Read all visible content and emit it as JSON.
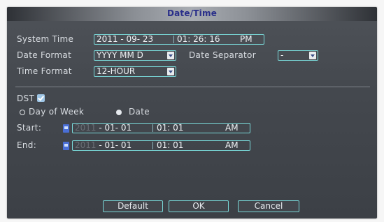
{
  "title": "Date/Time",
  "system_time": {
    "label": "System Time",
    "date": "2011 - 09- 23",
    "time": "01: 26: 16",
    "ampm": "PM"
  },
  "date_format": {
    "label": "Date Format",
    "value": "YYYY MM D"
  },
  "date_separator": {
    "label": "Date Separator",
    "value": "-"
  },
  "time_format": {
    "label": "Time Format",
    "value": "12-HOUR"
  },
  "dst": {
    "label": "DST",
    "checked": true,
    "mode_options": [
      "Day of Week",
      "Date"
    ],
    "selected_mode": "Date",
    "start": {
      "label": "Start:",
      "year": "2011",
      "date": "- 01- 01",
      "time": "01: 01",
      "ampm": "AM"
    },
    "end": {
      "label": "End:",
      "year": "2011",
      "date": "- 01- 01",
      "time": "01: 01",
      "ampm": "AM"
    }
  },
  "buttons": {
    "default": "Default",
    "ok": "OK",
    "cancel": "Cancel"
  },
  "colors": {
    "accent_border": "#79d8d8",
    "title_text": "#2a2f8a",
    "panel_bg": "#44484e"
  }
}
